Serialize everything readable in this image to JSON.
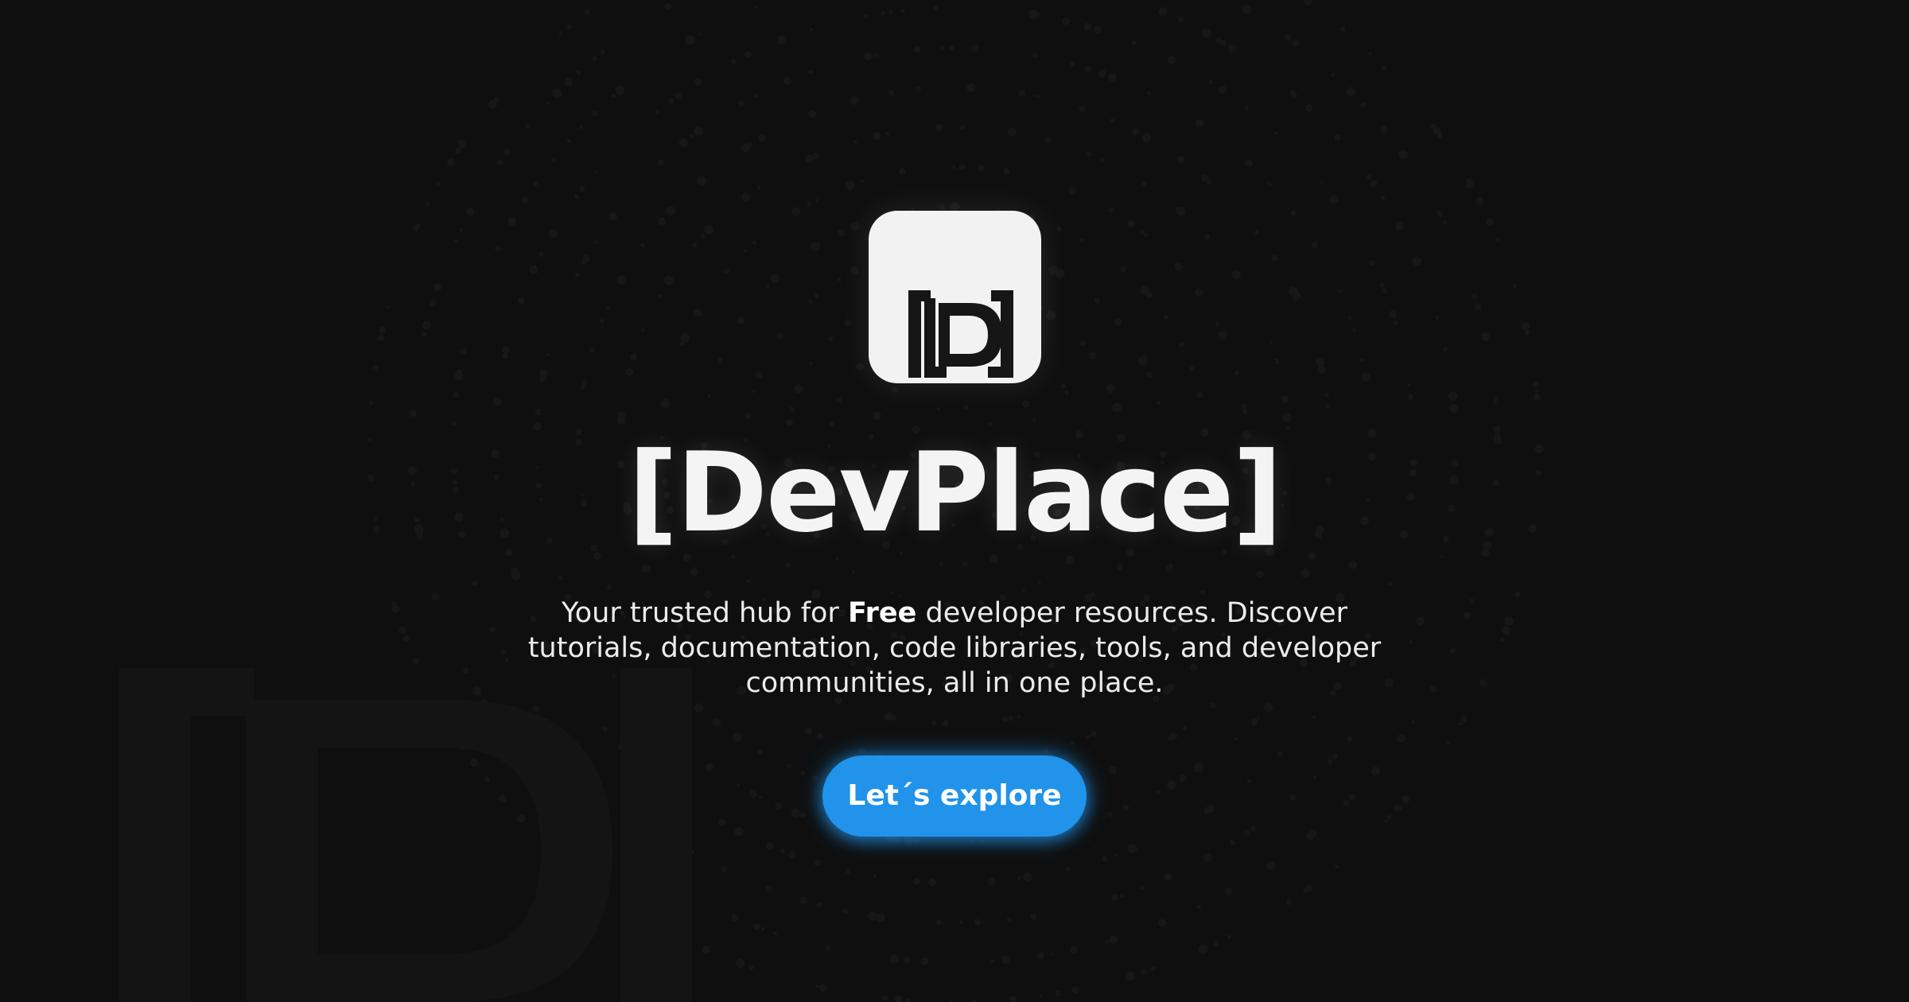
{
  "brand": {
    "title": "[DevPlace]",
    "logo_icon": "devplace-bracket-d-logo"
  },
  "hero": {
    "tagline_before": "Your trusted hub for ",
    "tagline_bold": "Free",
    "tagline_after": " developer resources. Discover tutorials, documentation, code libraries, tools, and developer communities, all in one place."
  },
  "cta": {
    "label": "Let´s explore"
  },
  "colors": {
    "background": "#0f0f0f",
    "text": "#f2f2f2",
    "accent": "#2193ea"
  }
}
